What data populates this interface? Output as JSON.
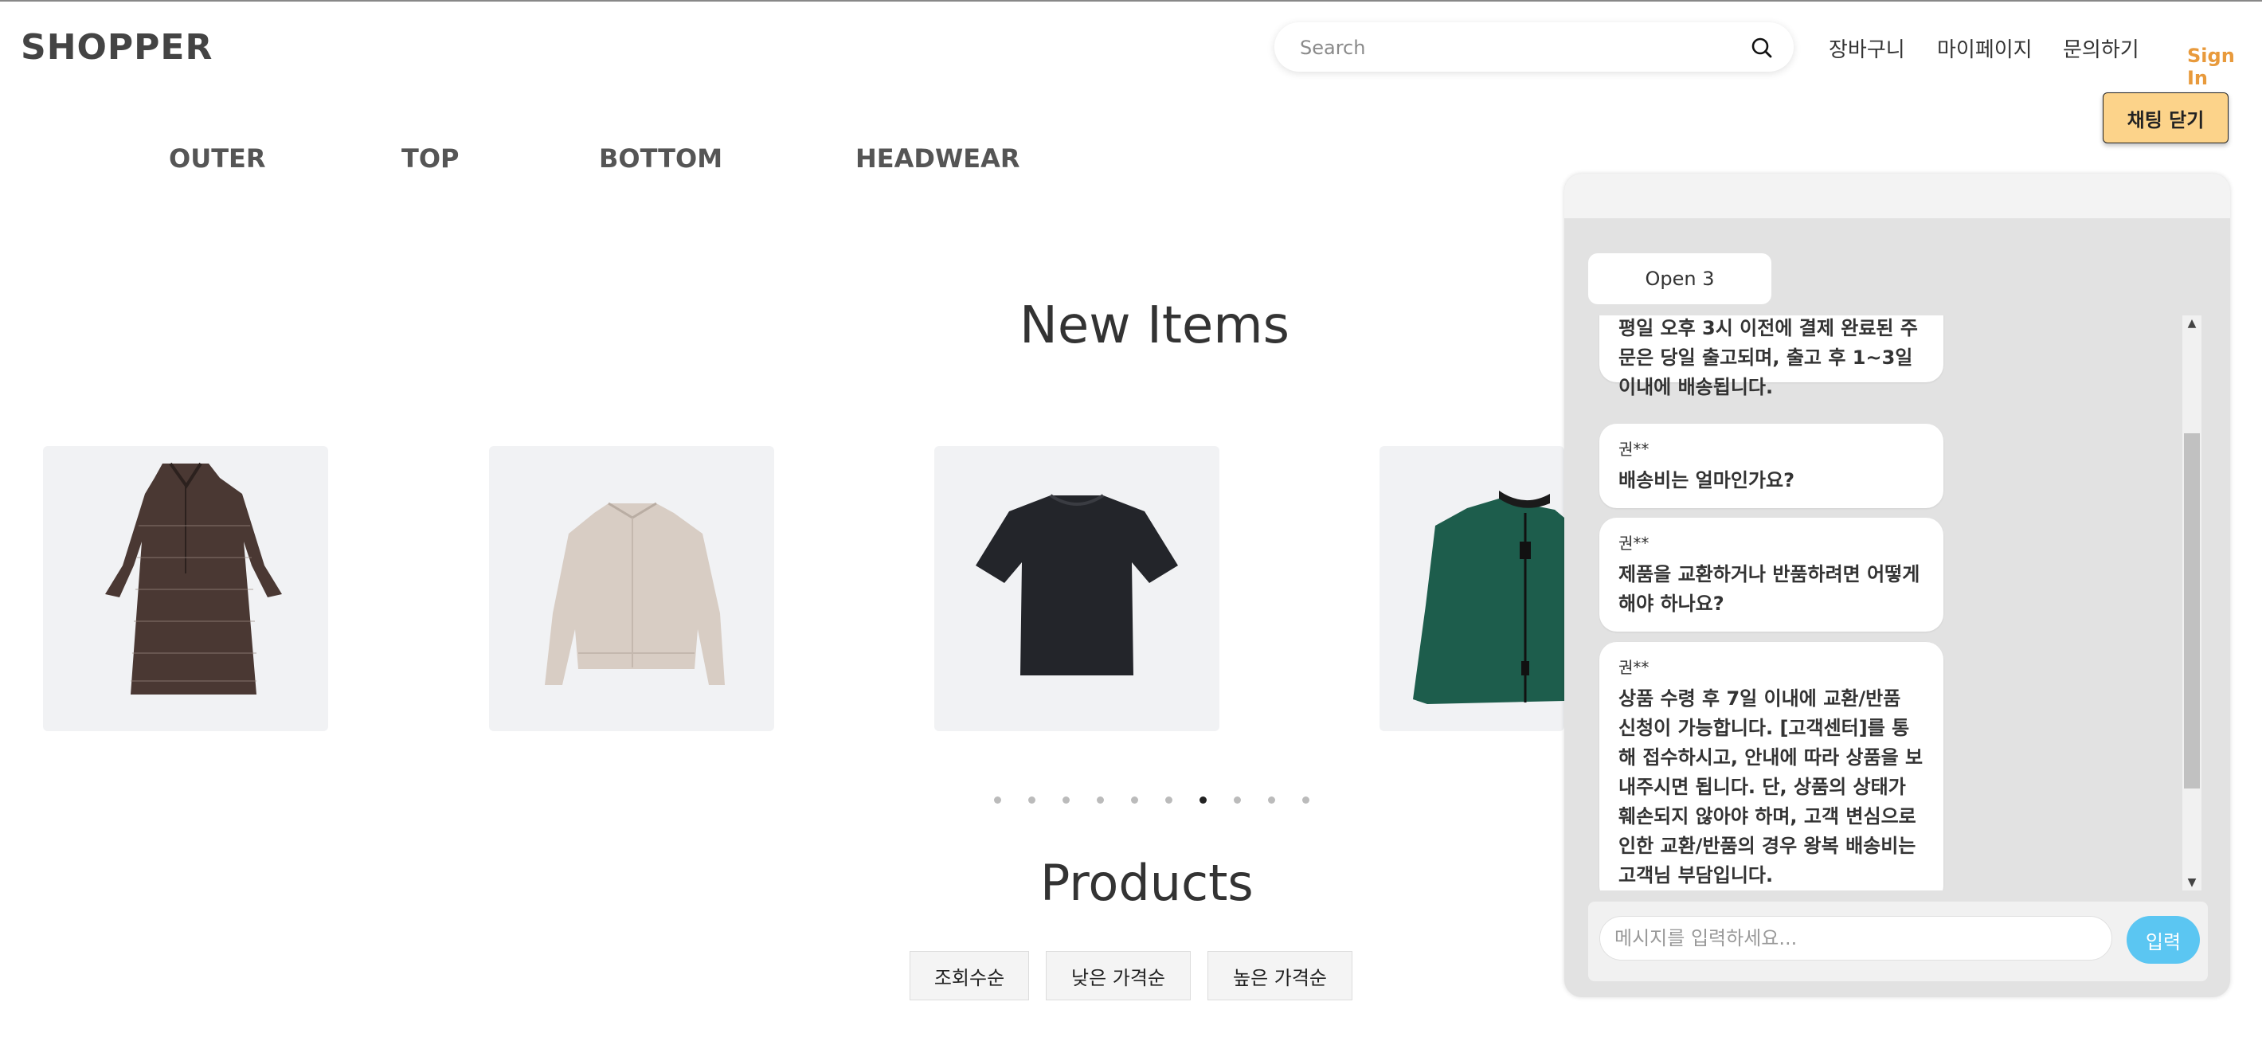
{
  "header": {
    "logo": "SHOPPER",
    "search_placeholder": "Search",
    "nav": [
      "장바구니",
      "마이페이지",
      "문의하기"
    ],
    "sign_in": "Sign In",
    "chat_toggle": "채팅 닫기"
  },
  "categories": [
    "OUTER",
    "TOP",
    "BOTTOM",
    "HEADWEAR"
  ],
  "new_items": {
    "title": "New Items",
    "products": [
      "dress",
      "light-jacket",
      "black-tshirt",
      "green-zip-jacket"
    ],
    "carousel": {
      "total": 10,
      "active": 7
    }
  },
  "products_section": {
    "title": "Products",
    "sort_options": [
      "조회수순",
      "낮은 가격순",
      "높은 가격순"
    ]
  },
  "chat": {
    "tab": "Open 3",
    "messages": [
      {
        "sender": "",
        "text": "평일 오후 3시 이전에 결제 완료된 주문은 당일 출고되며, 출고 후 1~3일 이내에 배송됩니다."
      },
      {
        "sender": "권**",
        "text": "배송비는 얼마인가요?"
      },
      {
        "sender": "권**",
        "text": "제품을 교환하거나 반품하려면 어떻게 해야 하나요?"
      },
      {
        "sender": "권**",
        "text": "상품 수령 후 7일 이내에 교환/반품 신청이 가능합니다. [고객센터]를 통해 접수하시고, 안내에 따라 상품을 보내주시면 됩니다. 단, 상품의 상태가 훼손되지 않아야 하며, 고객 변심으로 인한 교환/반품의 경우 왕복 배송비는 고객님 부담입니다."
      }
    ],
    "input_placeholder": "메시지를 입력하세요...",
    "send_label": "입력"
  }
}
